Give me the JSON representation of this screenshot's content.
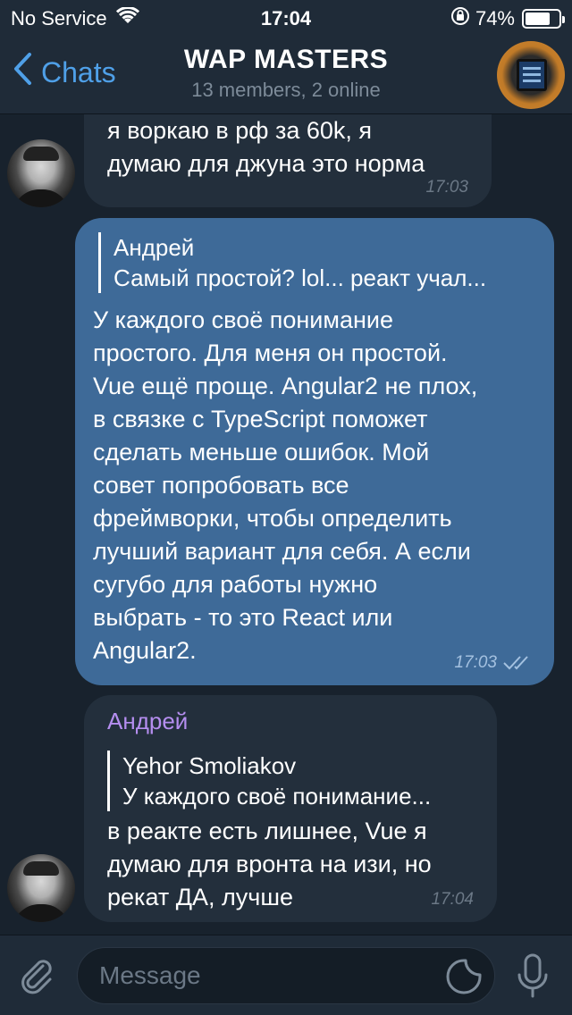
{
  "status_bar": {
    "carrier": "No Service",
    "time": "17:04",
    "battery_percent": "74%",
    "battery_level": 0.74
  },
  "nav": {
    "back_label": "Chats",
    "title": "WAP MASTERS",
    "subtitle": "13 members, 2 online",
    "accent_color": "#4fa0e8"
  },
  "messages": [
    {
      "direction": "incoming",
      "lines": [
        "я воркаю в рф за 60k, я",
        "думаю для джуна это норма"
      ],
      "time": "17:03"
    },
    {
      "direction": "outgoing",
      "reply_author": "Андрей",
      "reply_text": "Самый простой? lol... реакт учал...",
      "lines": [
        "У каждого своё понимание",
        "простого. Для меня он простой.",
        "Vue ещё проще. Angular2 не плох,",
        "в связке с TypeScript поможет",
        "сделать меньше ошибок. Мой",
        "совет попробовать все",
        "фреймворки, чтобы определить",
        "лучший вариант для себя. А если",
        "сугубо для работы нужно",
        "выбрать - то это React или",
        "Angular2."
      ],
      "time": "17:03",
      "status_icon": "double-check-icon"
    },
    {
      "direction": "incoming",
      "sender": "Андрей",
      "reply_author": "Yehor Smoliakov",
      "reply_text": "У каждого своё понимание...",
      "lines": [
        "в реакте есть лишнее, Vue я",
        "думаю для вронта на изи, но",
        "рекат ДА, лучше"
      ],
      "time": "17:04"
    }
  ],
  "input": {
    "placeholder": "Message"
  },
  "colors": {
    "background": "#18222d",
    "bar": "#1f2b38",
    "incoming_bubble": "#232f3c",
    "outgoing_bubble": "#3e6a98",
    "sender_name": "#b58ef0"
  }
}
